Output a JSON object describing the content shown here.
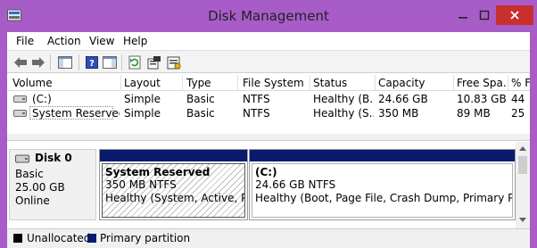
{
  "window": {
    "title": "Disk Management"
  },
  "menu": {
    "items": [
      "File",
      "Action",
      "View",
      "Help"
    ]
  },
  "toolbar": {
    "icons": [
      "back-arrow-icon",
      "forward-arrow-icon",
      "console-tree-icon",
      "help-icon",
      "action-pane-icon",
      "refresh-icon",
      "properties-icon",
      "settings-icon"
    ]
  },
  "volumes": {
    "columns": [
      "Volume",
      "Layout",
      "Type",
      "File System",
      "Status",
      "Capacity",
      "Free Spa...",
      "% F"
    ],
    "rows": [
      {
        "volume": "(C:)",
        "layout": "Simple",
        "type": "Basic",
        "fs": "NTFS",
        "status": "Healthy (B...",
        "capacity": "24.66 GB",
        "free": "10.83 GB",
        "pct": "44"
      },
      {
        "volume": "System Reserved",
        "layout": "Simple",
        "type": "Basic",
        "fs": "NTFS",
        "status": "Healthy (S...",
        "capacity": "350 MB",
        "free": "89 MB",
        "pct": "25"
      }
    ]
  },
  "disk": {
    "name": "Disk 0",
    "kind": "Basic",
    "size": "25.00 GB",
    "state": "Online",
    "partitions": [
      {
        "title": "System Reserved",
        "size": "350 MB NTFS",
        "status": "Healthy (System, Active, Primar"
      },
      {
        "title": "(C:)",
        "size": "24.66 GB NTFS",
        "status": "Healthy (Boot, Page File, Crash Dump, Primary Partition)"
      }
    ]
  },
  "legend": {
    "items": [
      {
        "label": "Unallocated",
        "color": "#000000"
      },
      {
        "label": "Primary partition",
        "color": "#0a1a6e"
      }
    ]
  },
  "colors": {
    "title_bar": "#a85cc8",
    "close_button": "#c7302c",
    "partition_bar": "#0a1a6e"
  }
}
